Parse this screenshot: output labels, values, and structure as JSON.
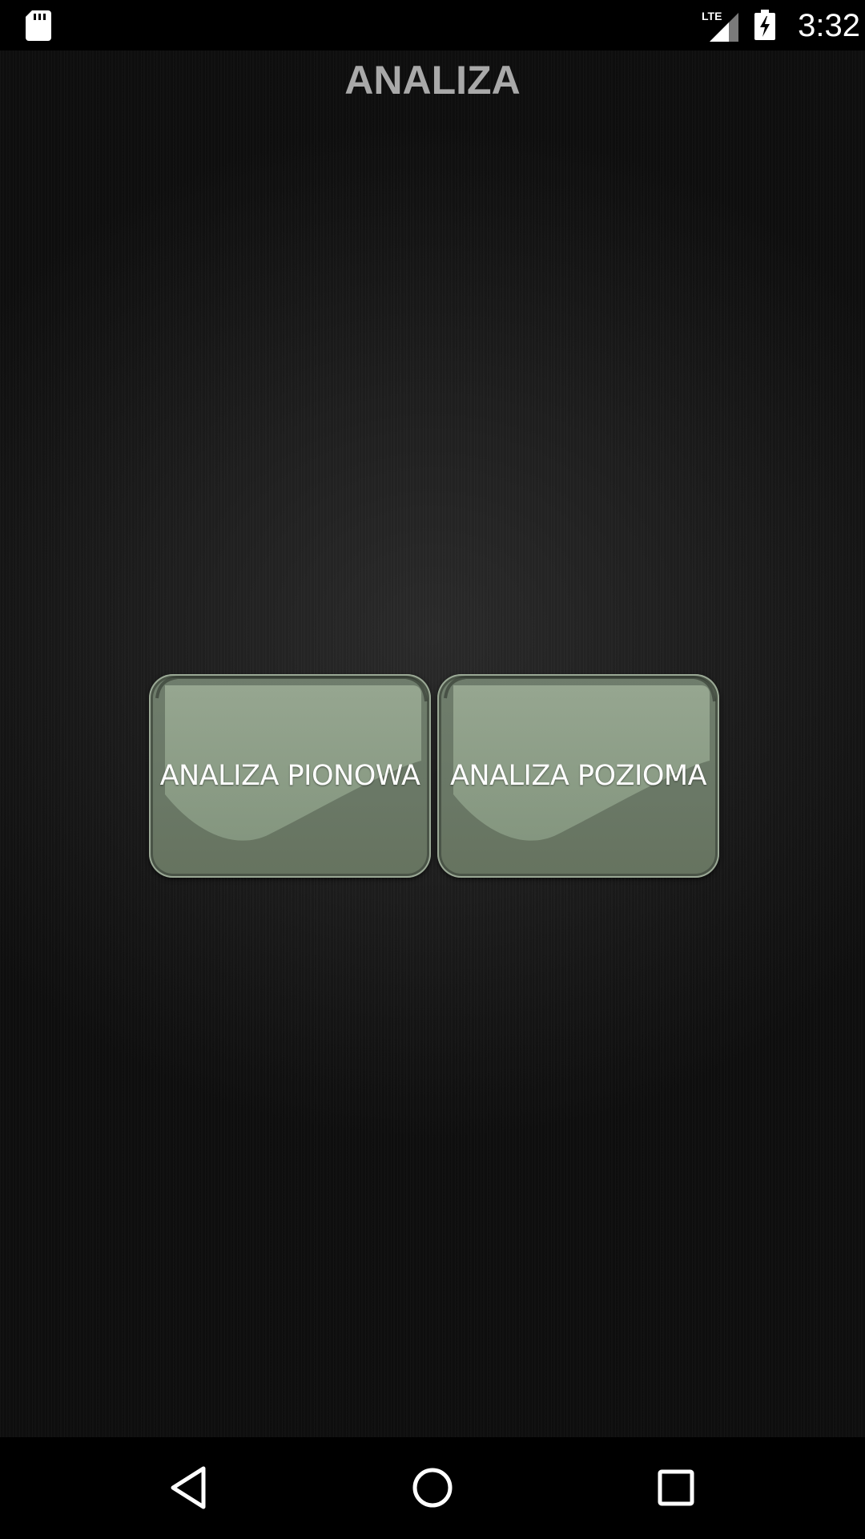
{
  "status_bar": {
    "time": "3:32",
    "network": "LTE",
    "icons": [
      "sd-card-icon",
      "lte-signal-icon",
      "battery-charging-icon"
    ]
  },
  "page": {
    "title": "ANALIZA"
  },
  "buttons": {
    "vertical_label": "ANALIZA PIONOWA",
    "horizontal_label": "ANALIZA POZIOMA"
  },
  "nav_bar": {
    "icons": [
      "back-icon",
      "home-icon",
      "recents-icon"
    ]
  },
  "colors": {
    "button_face": "#6f7d6c",
    "button_highlight": "#8b9c86",
    "title_text": "#a9a9a9",
    "background": "#1f1f1f"
  }
}
